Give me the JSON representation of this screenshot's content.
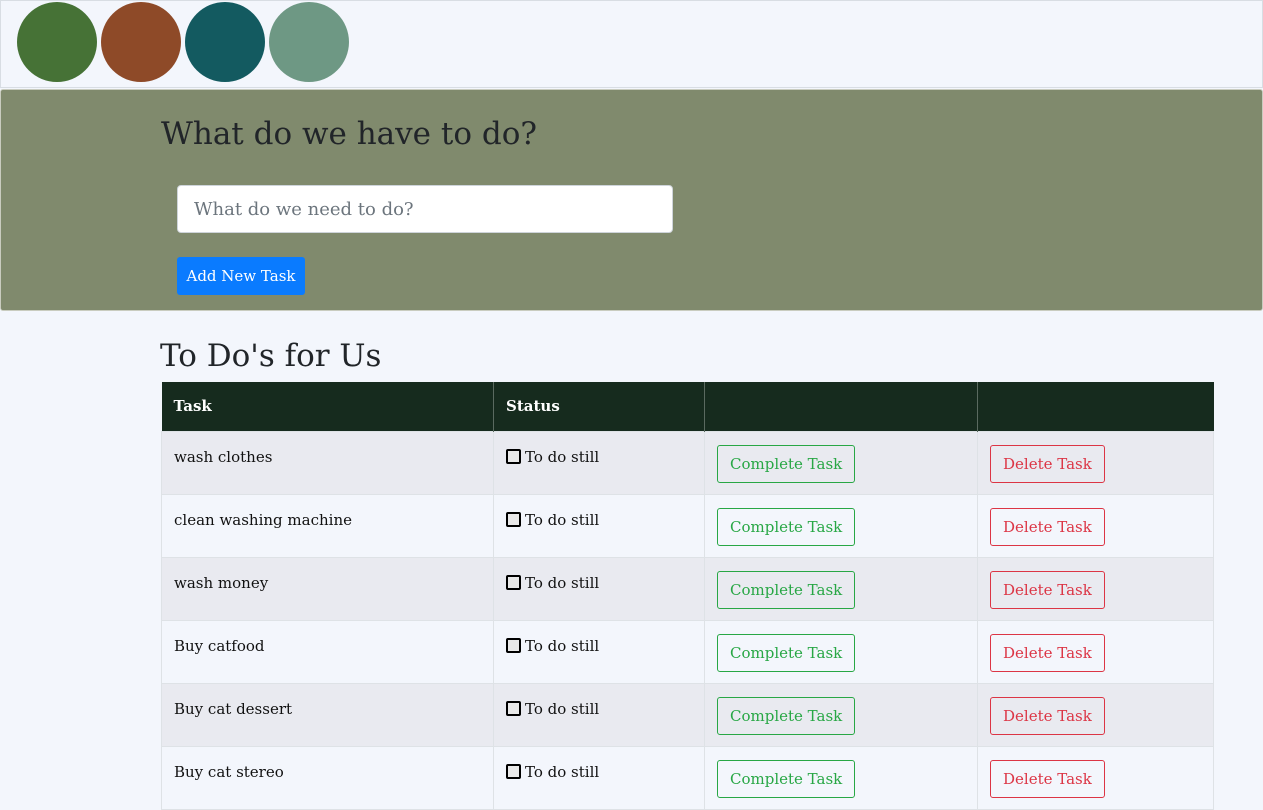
{
  "colors": {
    "swatches": [
      "#467236",
      "#8e4a28",
      "#135a60",
      "#6e9884"
    ],
    "hero_bg": "#808a6d",
    "table_header_bg": "#162b1e",
    "row_odd": "#e9eaf0",
    "row_even": "#f3f6fc",
    "primary": "#0a7bff",
    "success": "#28a745",
    "danger": "#dc3545"
  },
  "hero": {
    "title": "What do we have to do?",
    "input_placeholder": "What do we need to do?",
    "input_value": "",
    "add_button": "Add New Task"
  },
  "list": {
    "title": "To Do's for Us",
    "columns": [
      "Task",
      "Status",
      "",
      ""
    ],
    "complete_label": "Complete Task",
    "delete_label": "Delete Task",
    "rows": [
      {
        "task": "wash clothes",
        "status": "To do still"
      },
      {
        "task": "clean washing machine",
        "status": "To do still"
      },
      {
        "task": "wash money",
        "status": "To do still"
      },
      {
        "task": "Buy catfood",
        "status": "To do still"
      },
      {
        "task": "Buy cat dessert",
        "status": "To do still"
      },
      {
        "task": "Buy cat stereo",
        "status": "To do still"
      }
    ]
  }
}
